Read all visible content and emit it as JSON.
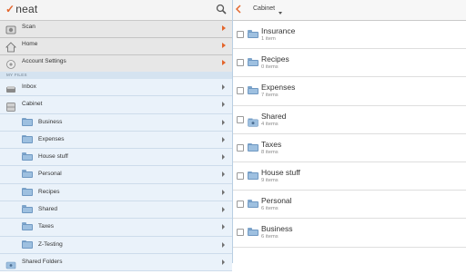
{
  "app": {
    "logo_text": "neat"
  },
  "menu": [
    {
      "label": "Scan",
      "icon": "scanner-icon",
      "name": "menu-item-scan"
    },
    {
      "label": "Home",
      "icon": "home-icon",
      "name": "menu-item-home"
    },
    {
      "label": "Account Settings",
      "icon": "gear-icon",
      "name": "menu-item-account-settings"
    }
  ],
  "section_header": "MY FILES",
  "tree": [
    {
      "label": "Inbox",
      "icon": "inbox-tray-icon",
      "level": 0,
      "name": "tree-item-inbox"
    },
    {
      "label": "Cabinet",
      "icon": "cabinet-icon",
      "level": 0,
      "name": "tree-item-cabinet"
    },
    {
      "label": "Business",
      "icon": "folder-icon",
      "level": 1,
      "name": "tree-item-business"
    },
    {
      "label": "Expenses",
      "icon": "folder-icon",
      "level": 1,
      "name": "tree-item-expenses"
    },
    {
      "label": "House stuff",
      "icon": "folder-icon",
      "level": 1,
      "name": "tree-item-house-stuff"
    },
    {
      "label": "Personal",
      "icon": "folder-icon",
      "level": 1,
      "name": "tree-item-personal"
    },
    {
      "label": "Recipes",
      "icon": "folder-icon",
      "level": 1,
      "name": "tree-item-recipes"
    },
    {
      "label": "Shared",
      "icon": "folder-icon",
      "level": 1,
      "name": "tree-item-shared"
    },
    {
      "label": "Taxes",
      "icon": "folder-icon",
      "level": 1,
      "name": "tree-item-taxes"
    },
    {
      "label": "Z-Testing",
      "icon": "folder-icon",
      "level": 1,
      "name": "tree-item-z-testing"
    },
    {
      "label": "Shared Folders",
      "icon": "shared-folders-icon",
      "level": 0,
      "name": "tree-item-shared-folders"
    }
  ],
  "right": {
    "breadcrumb": "Cabinet",
    "items": [
      {
        "name": "Insurance",
        "count": "1 item",
        "icon": "folder-icon"
      },
      {
        "name": "Recipes",
        "count": "0 items",
        "icon": "folder-icon"
      },
      {
        "name": "Expenses",
        "count": "7 items",
        "icon": "folder-icon"
      },
      {
        "name": "Shared",
        "count": "4 items",
        "icon": "shared-folder-icon"
      },
      {
        "name": "Taxes",
        "count": "8 items",
        "icon": "folder-icon"
      },
      {
        "name": "House stuff",
        "count": "9 items",
        "icon": "folder-icon"
      },
      {
        "name": "Personal",
        "count": "6 items",
        "icon": "folder-icon"
      },
      {
        "name": "Business",
        "count": "6 items",
        "icon": "folder-icon"
      }
    ]
  },
  "colors": {
    "accent": "#e4652b",
    "sidebar_bg": "#eaf2fa",
    "folder": "#9ec0e0"
  }
}
